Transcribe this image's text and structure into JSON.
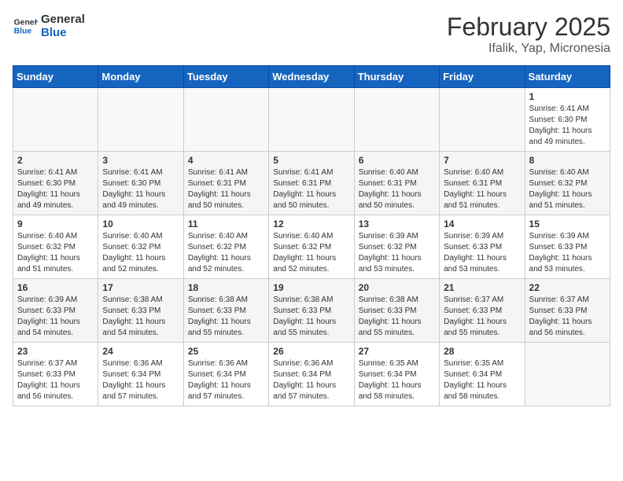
{
  "header": {
    "logo_line1": "General",
    "logo_line2": "Blue",
    "month_title": "February 2025",
    "location": "Ifalik, Yap, Micronesia"
  },
  "weekdays": [
    "Sunday",
    "Monday",
    "Tuesday",
    "Wednesday",
    "Thursday",
    "Friday",
    "Saturday"
  ],
  "weeks": [
    [
      {
        "day": "",
        "info": ""
      },
      {
        "day": "",
        "info": ""
      },
      {
        "day": "",
        "info": ""
      },
      {
        "day": "",
        "info": ""
      },
      {
        "day": "",
        "info": ""
      },
      {
        "day": "",
        "info": ""
      },
      {
        "day": "1",
        "info": "Sunrise: 6:41 AM\nSunset: 6:30 PM\nDaylight: 11 hours\nand 49 minutes."
      }
    ],
    [
      {
        "day": "2",
        "info": "Sunrise: 6:41 AM\nSunset: 6:30 PM\nDaylight: 11 hours\nand 49 minutes."
      },
      {
        "day": "3",
        "info": "Sunrise: 6:41 AM\nSunset: 6:30 PM\nDaylight: 11 hours\nand 49 minutes."
      },
      {
        "day": "4",
        "info": "Sunrise: 6:41 AM\nSunset: 6:31 PM\nDaylight: 11 hours\nand 50 minutes."
      },
      {
        "day": "5",
        "info": "Sunrise: 6:41 AM\nSunset: 6:31 PM\nDaylight: 11 hours\nand 50 minutes."
      },
      {
        "day": "6",
        "info": "Sunrise: 6:40 AM\nSunset: 6:31 PM\nDaylight: 11 hours\nand 50 minutes."
      },
      {
        "day": "7",
        "info": "Sunrise: 6:40 AM\nSunset: 6:31 PM\nDaylight: 11 hours\nand 51 minutes."
      },
      {
        "day": "8",
        "info": "Sunrise: 6:40 AM\nSunset: 6:32 PM\nDaylight: 11 hours\nand 51 minutes."
      }
    ],
    [
      {
        "day": "9",
        "info": "Sunrise: 6:40 AM\nSunset: 6:32 PM\nDaylight: 11 hours\nand 51 minutes."
      },
      {
        "day": "10",
        "info": "Sunrise: 6:40 AM\nSunset: 6:32 PM\nDaylight: 11 hours\nand 52 minutes."
      },
      {
        "day": "11",
        "info": "Sunrise: 6:40 AM\nSunset: 6:32 PM\nDaylight: 11 hours\nand 52 minutes."
      },
      {
        "day": "12",
        "info": "Sunrise: 6:40 AM\nSunset: 6:32 PM\nDaylight: 11 hours\nand 52 minutes."
      },
      {
        "day": "13",
        "info": "Sunrise: 6:39 AM\nSunset: 6:32 PM\nDaylight: 11 hours\nand 53 minutes."
      },
      {
        "day": "14",
        "info": "Sunrise: 6:39 AM\nSunset: 6:33 PM\nDaylight: 11 hours\nand 53 minutes."
      },
      {
        "day": "15",
        "info": "Sunrise: 6:39 AM\nSunset: 6:33 PM\nDaylight: 11 hours\nand 53 minutes."
      }
    ],
    [
      {
        "day": "16",
        "info": "Sunrise: 6:39 AM\nSunset: 6:33 PM\nDaylight: 11 hours\nand 54 minutes."
      },
      {
        "day": "17",
        "info": "Sunrise: 6:38 AM\nSunset: 6:33 PM\nDaylight: 11 hours\nand 54 minutes."
      },
      {
        "day": "18",
        "info": "Sunrise: 6:38 AM\nSunset: 6:33 PM\nDaylight: 11 hours\nand 55 minutes."
      },
      {
        "day": "19",
        "info": "Sunrise: 6:38 AM\nSunset: 6:33 PM\nDaylight: 11 hours\nand 55 minutes."
      },
      {
        "day": "20",
        "info": "Sunrise: 6:38 AM\nSunset: 6:33 PM\nDaylight: 11 hours\nand 55 minutes."
      },
      {
        "day": "21",
        "info": "Sunrise: 6:37 AM\nSunset: 6:33 PM\nDaylight: 11 hours\nand 55 minutes."
      },
      {
        "day": "22",
        "info": "Sunrise: 6:37 AM\nSunset: 6:33 PM\nDaylight: 11 hours\nand 56 minutes."
      }
    ],
    [
      {
        "day": "23",
        "info": "Sunrise: 6:37 AM\nSunset: 6:33 PM\nDaylight: 11 hours\nand 56 minutes."
      },
      {
        "day": "24",
        "info": "Sunrise: 6:36 AM\nSunset: 6:34 PM\nDaylight: 11 hours\nand 57 minutes."
      },
      {
        "day": "25",
        "info": "Sunrise: 6:36 AM\nSunset: 6:34 PM\nDaylight: 11 hours\nand 57 minutes."
      },
      {
        "day": "26",
        "info": "Sunrise: 6:36 AM\nSunset: 6:34 PM\nDaylight: 11 hours\nand 57 minutes."
      },
      {
        "day": "27",
        "info": "Sunrise: 6:35 AM\nSunset: 6:34 PM\nDaylight: 11 hours\nand 58 minutes."
      },
      {
        "day": "28",
        "info": "Sunrise: 6:35 AM\nSunset: 6:34 PM\nDaylight: 11 hours\nand 58 minutes."
      },
      {
        "day": "",
        "info": ""
      }
    ]
  ]
}
